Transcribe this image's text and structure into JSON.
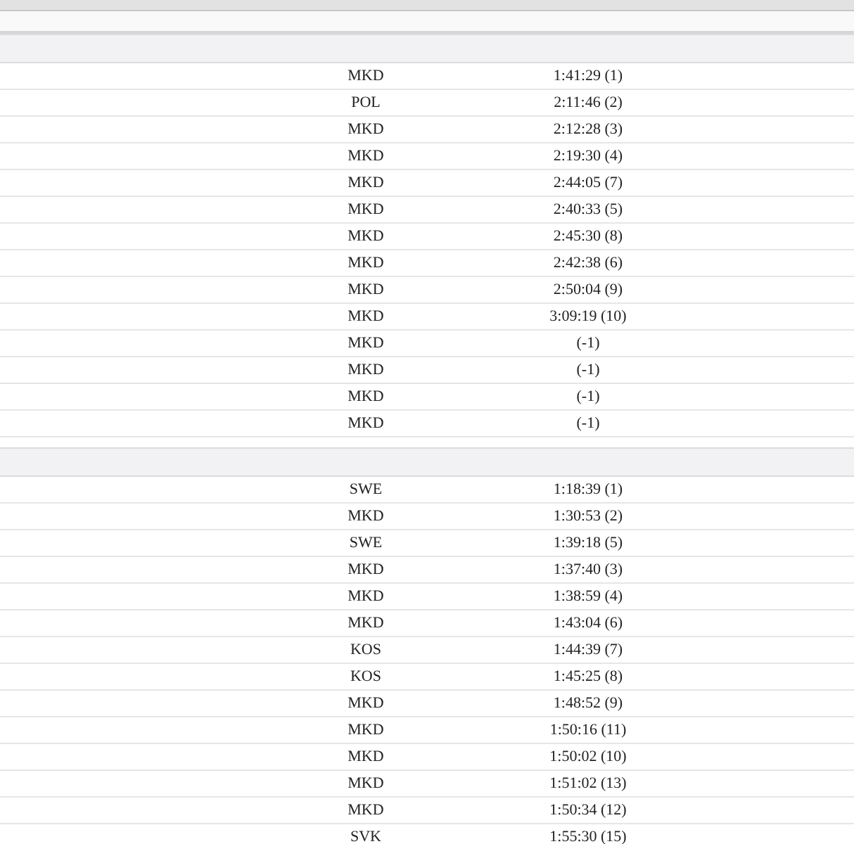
{
  "groups": [
    {
      "rows": [
        {
          "country": "MKD",
          "time": "1:41:29 (1)"
        },
        {
          "country": "POL",
          "time": "2:11:46 (2)"
        },
        {
          "country": "MKD",
          "time": "2:12:28 (3)"
        },
        {
          "country": "MKD",
          "time": "2:19:30 (4)"
        },
        {
          "country": "MKD",
          "time": "2:44:05 (7)"
        },
        {
          "country": "MKD",
          "time": "2:40:33 (5)"
        },
        {
          "country": "MKD",
          "time": "2:45:30 (8)"
        },
        {
          "country": "MKD",
          "time": "2:42:38 (6)"
        },
        {
          "country": "MKD",
          "time": "2:50:04 (9)"
        },
        {
          "country": "MKD",
          "time": "3:09:19 (10)"
        },
        {
          "country": "MKD",
          "time": "(-1)"
        },
        {
          "country": "MKD",
          "time": "(-1)"
        },
        {
          "country": "MKD",
          "time": "(-1)"
        },
        {
          "country": "MKD",
          "time": "(-1)"
        }
      ]
    },
    {
      "rows": [
        {
          "country": "SWE",
          "time": "1:18:39 (1)"
        },
        {
          "country": "MKD",
          "time": "1:30:53 (2)"
        },
        {
          "country": "SWE",
          "time": "1:39:18 (5)"
        },
        {
          "country": "MKD",
          "time": "1:37:40 (3)"
        },
        {
          "country": "MKD",
          "time": "1:38:59 (4)"
        },
        {
          "country": "MKD",
          "time": "1:43:04 (6)"
        },
        {
          "country": "KOS",
          "time": "1:44:39 (7)"
        },
        {
          "country": "KOS",
          "time": "1:45:25 (8)"
        },
        {
          "country": "MKD",
          "time": "1:48:52 (9)"
        },
        {
          "country": "MKD",
          "time": "1:50:16 (11)"
        },
        {
          "country": "MKD",
          "time": "1:50:02 (10)"
        },
        {
          "country": "MKD",
          "time": "1:51:02 (13)"
        },
        {
          "country": "MKD",
          "time": "1:50:34 (12)"
        },
        {
          "country": "SVK",
          "time": "1:55:30 (15)"
        }
      ]
    }
  ]
}
